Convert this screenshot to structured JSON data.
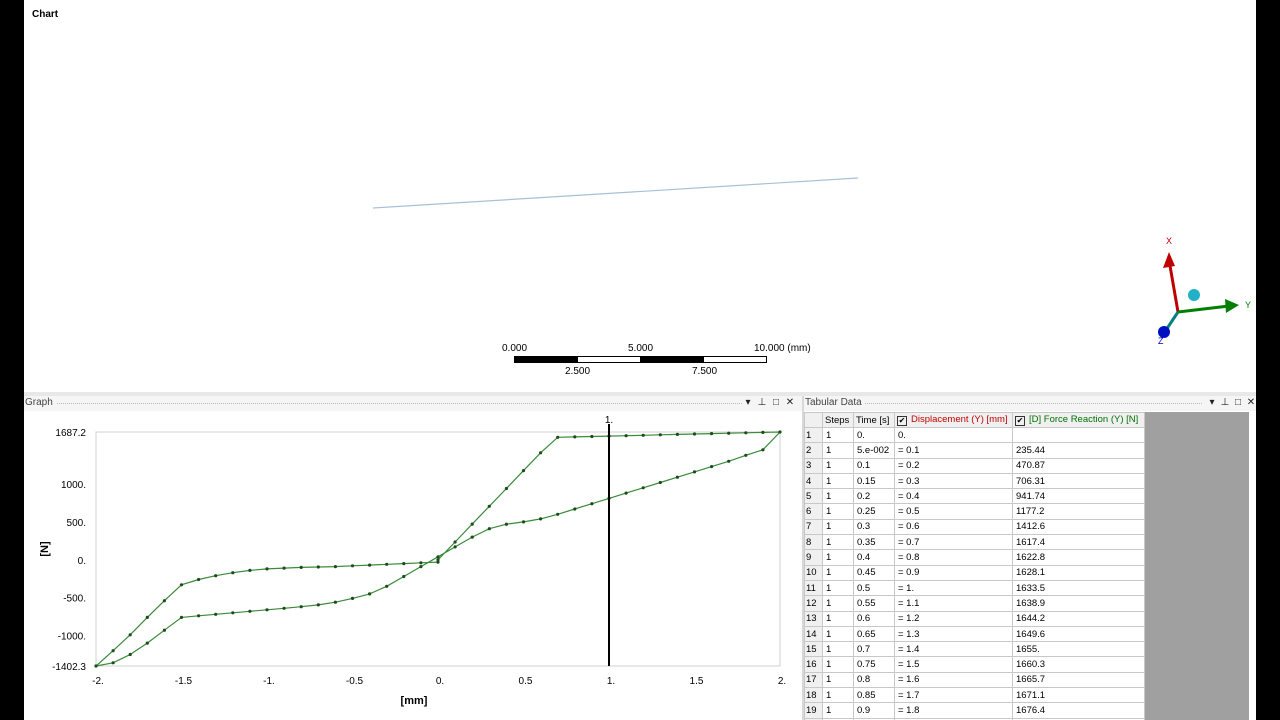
{
  "viewport": {
    "title": "Chart",
    "scale_bar": {
      "top_labels": [
        "0.000",
        "5.000",
        "10.000 (mm)"
      ],
      "bottom_labels": [
        "2.500",
        "7.500"
      ]
    },
    "triad": {
      "x_label": "X",
      "y_label": "Y",
      "z_label": "Z",
      "x_color": "#c00000",
      "y_color": "#008000",
      "z_color": "#0000c0"
    }
  },
  "graph_panel": {
    "title": "Graph",
    "controls": [
      "▾",
      "⊥",
      "□",
      "✕"
    ],
    "cursor_label": "1."
  },
  "tabular_panel": {
    "title": "Tabular Data",
    "controls": [
      "▾",
      "⊥",
      "□",
      "✕"
    ],
    "columns": [
      "",
      "Steps",
      "Time [s]",
      "Displacement (Y) [mm]",
      "[D] Force Reaction (Y) [N]"
    ],
    "rows": [
      [
        "1",
        "1",
        "0.",
        "0.",
        ""
      ],
      [
        "2",
        "1",
        "5.e-002",
        "= 0.1",
        "235.44"
      ],
      [
        "3",
        "1",
        "0.1",
        "= 0.2",
        "470.87"
      ],
      [
        "4",
        "1",
        "0.15",
        "= 0.3",
        "706.31"
      ],
      [
        "5",
        "1",
        "0.2",
        "= 0.4",
        "941.74"
      ],
      [
        "6",
        "1",
        "0.25",
        "= 0.5",
        "1177.2"
      ],
      [
        "7",
        "1",
        "0.3",
        "= 0.6",
        "1412.6"
      ],
      [
        "8",
        "1",
        "0.35",
        "= 0.7",
        "1617.4"
      ],
      [
        "9",
        "1",
        "0.4",
        "= 0.8",
        "1622.8"
      ],
      [
        "10",
        "1",
        "0.45",
        "= 0.9",
        "1628.1"
      ],
      [
        "11",
        "1",
        "0.5",
        "= 1.",
        "1633.5"
      ],
      [
        "12",
        "1",
        "0.55",
        "= 1.1",
        "1638.9"
      ],
      [
        "13",
        "1",
        "0.6",
        "= 1.2",
        "1644.2"
      ],
      [
        "14",
        "1",
        "0.65",
        "= 1.3",
        "1649.6"
      ],
      [
        "15",
        "1",
        "0.7",
        "= 1.4",
        "1655."
      ],
      [
        "16",
        "1",
        "0.75",
        "= 1.5",
        "1660.3"
      ],
      [
        "17",
        "1",
        "0.8",
        "= 1.6",
        "1665.7"
      ],
      [
        "18",
        "1",
        "0.85",
        "= 1.7",
        "1671.1"
      ],
      [
        "19",
        "1",
        "0.9",
        "= 1.8",
        "1676.4"
      ],
      [
        "20",
        "1",
        "0.95",
        "= 1.9",
        "1681.8"
      ]
    ]
  },
  "chart_data": {
    "type": "line",
    "xlabel": "[mm]",
    "ylabel": "[N]",
    "xlim": [
      -2,
      2
    ],
    "ylim": [
      -1402.3,
      1687.2
    ],
    "x_ticks": [
      "-2.",
      "-1.5",
      "-1.",
      "-0.5",
      "0.",
      "0.5",
      "1.",
      "1.5",
      "2."
    ],
    "x_tick_values": [
      -2,
      -1.5,
      -1,
      -0.5,
      0,
      0.5,
      1,
      1.5,
      2
    ],
    "y_ticks": [
      "1687.2",
      "1000.",
      "500.",
      "0.",
      "-500.",
      "-1000.",
      "-1402.3"
    ],
    "y_tick_values": [
      1687.2,
      1000,
      500,
      0,
      -500,
      -1000,
      -1402.3
    ],
    "cursor_x": 1.0,
    "line_color": "#3a8a3a",
    "series": [
      {
        "x": [
          0,
          0.1,
          0.2,
          0.3,
          0.4,
          0.5,
          0.6,
          0.7,
          0.8,
          0.9,
          1.0,
          1.1,
          1.2,
          1.3,
          1.4,
          1.5,
          1.6,
          1.7,
          1.8,
          1.9,
          2.0,
          1.9,
          1.8,
          1.7,
          1.6,
          1.5,
          1.4,
          1.3,
          1.2,
          1.1,
          1.0,
          0.9,
          0.8,
          0.7,
          0.6,
          0.5,
          0.4,
          0.3,
          0.2,
          0.1,
          0.0,
          -0.1,
          -0.2,
          -0.3,
          -0.4,
          -0.5,
          -0.6,
          -0.7,
          -0.8,
          -0.9,
          -1.0,
          -1.1,
          -1.2,
          -1.3,
          -1.4,
          -1.5,
          -1.6,
          -1.7,
          -1.8,
          -1.9,
          -2.0,
          -1.9,
          -1.8,
          -1.7,
          -1.6,
          -1.5,
          -1.4,
          -1.3,
          -1.2,
          -1.1,
          -1.0,
          -0.9,
          -0.8,
          -0.7,
          -0.6,
          -0.5,
          -0.4,
          -0.3,
          -0.2,
          -0.1,
          0.0
        ],
        "y": [
          0,
          235.44,
          470.87,
          706.31,
          941.74,
          1177.2,
          1412.6,
          1617.4,
          1622.8,
          1628.1,
          1633.5,
          1638.9,
          1644.2,
          1649.6,
          1655,
          1660.3,
          1665.7,
          1671.1,
          1676.4,
          1681.8,
          1687.2,
          1452,
          1380,
          1300,
          1230,
          1160,
          1090,
          1020,
          950,
          880,
          810,
          740,
          670,
          600,
          540,
          500,
          470,
          410,
          300,
          170,
          40,
          -90,
          -220,
          -350,
          -450,
          -510,
          -560,
          -595,
          -620,
          -640,
          -660,
          -680,
          -700,
          -720,
          -740,
          -760,
          -930,
          -1100,
          -1250,
          -1360,
          -1402.3,
          -1200,
          -990,
          -760,
          -540,
          -330,
          -260,
          -210,
          -170,
          -140,
          -120,
          -110,
          -100,
          -95,
          -90,
          -80,
          -70,
          -60,
          -50,
          -40,
          -30
        ],
        "markers": true
      }
    ]
  }
}
